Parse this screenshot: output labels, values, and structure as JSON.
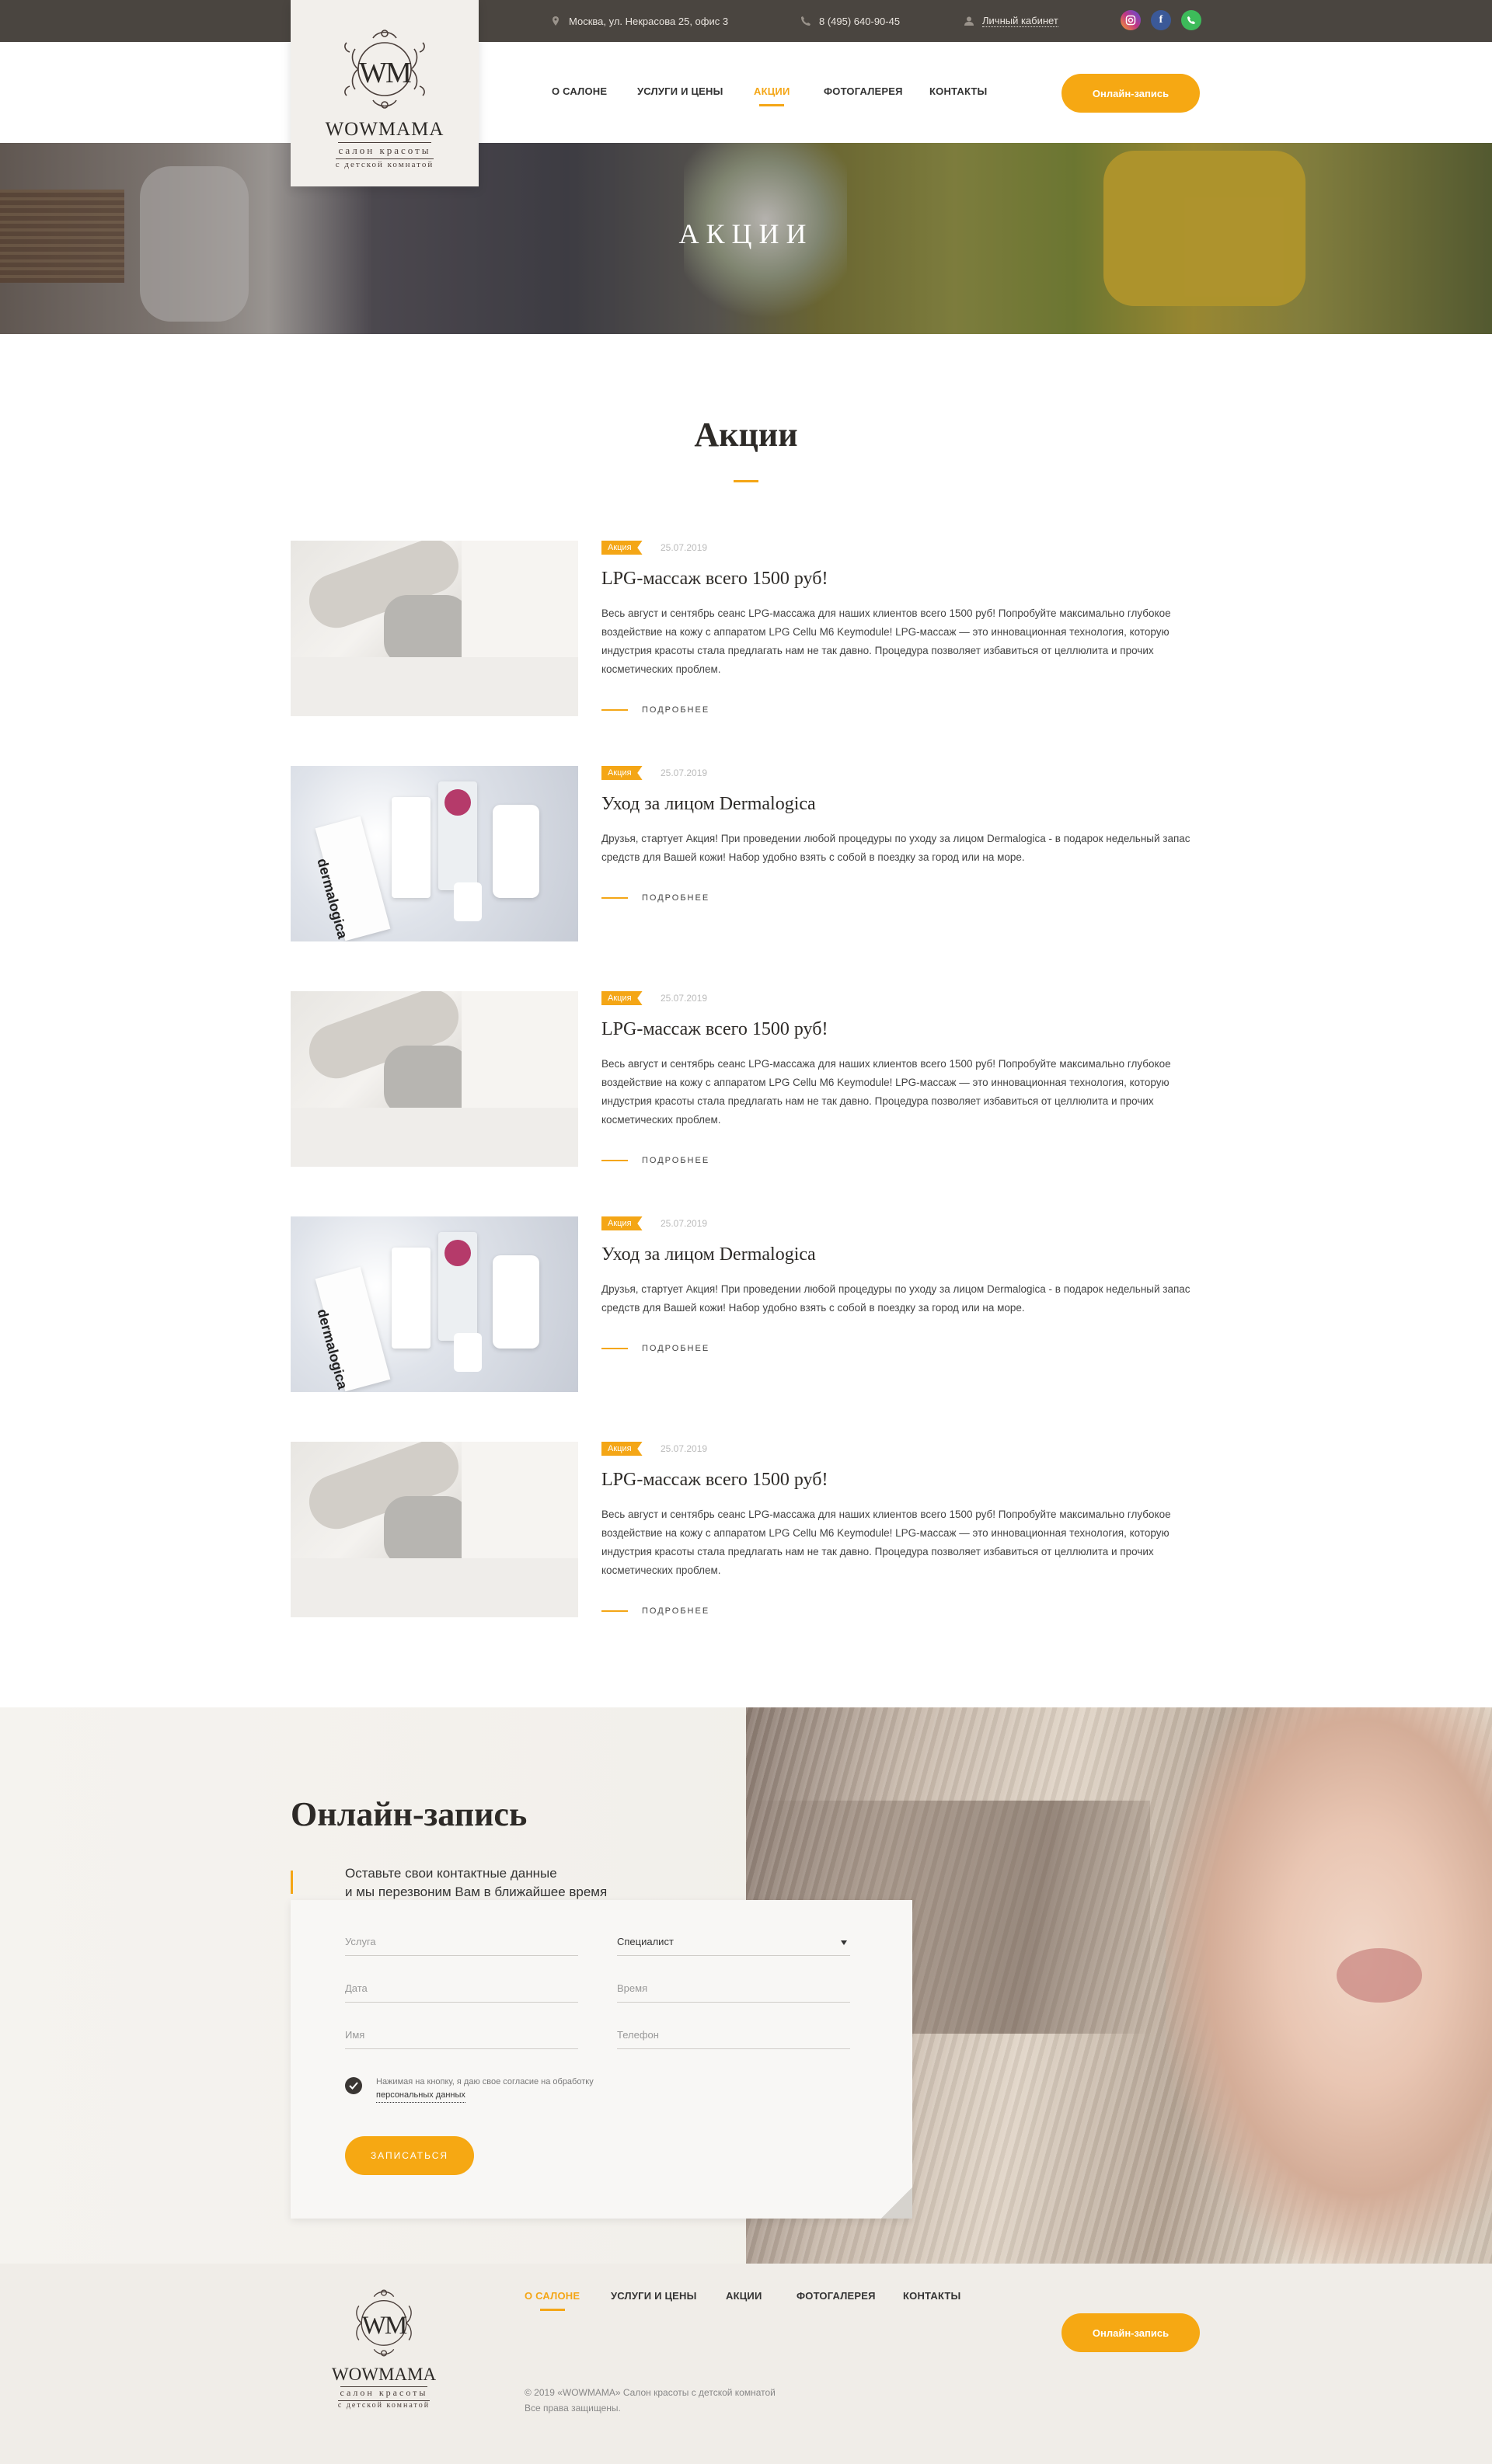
{
  "topbar": {
    "address": "Москва, ул. Некрасова 25, офис 3",
    "phone": "8 (495) 640-90-45",
    "account": "Личный кабинет",
    "social": [
      {
        "icon": "instagram-icon",
        "color": "#c13584"
      },
      {
        "icon": "facebook-icon",
        "color": "#3b5998",
        "glyph": "f"
      },
      {
        "icon": "whatsapp-icon",
        "color": "#3dbb5a"
      }
    ]
  },
  "logo": {
    "mono": "WM",
    "name": "WOWMAMA",
    "tag1": "салон красоты",
    "tag2": "с детской комнатой"
  },
  "nav": {
    "items": [
      "О салоне",
      "Услуги и цены",
      "Акции",
      "Фотогалерея",
      "Контакты"
    ],
    "active": 2,
    "cta": "Онлайн-запись"
  },
  "hero": {
    "title": "Акции"
  },
  "promos_section": {
    "title": "Акции"
  },
  "promos": [
    {
      "badge": "Акция",
      "date": "25.07.2019",
      "title": "LPG-массаж всего 1500 руб!",
      "text": "Весь август и сентябрь сеанс LPG-массажа для наших клиентов всего 1500 руб! Попробуйте максимально глубокое воздействие на кожу с аппаратом LPG Cellu M6 Keymodule!  LPG-массаж — это инновационная технология, которую индустрия красоты стала предлагать нам не так давно. Процедура позволяет избавиться от целлюлита и прочих косметических проблем.",
      "more": "Подробнее"
    },
    {
      "badge": "Акция",
      "date": "25.07.2019",
      "title": "Уход за лицом Dermalogica",
      "text": "Друзья, стартует Акция! При проведении любой процедуры по уходу за лицом Dermalogica - в подарок недельный запас средств для Вашей кожи! Набор удобно взять с собой в поездку за город или на море.",
      "more": "Подробнее"
    },
    {
      "badge": "Акция",
      "date": "25.07.2019",
      "title": "LPG-массаж всего 1500 руб!",
      "text": "Весь август и сентябрь сеанс LPG-массажа для наших клиентов всего 1500 руб! Попробуйте максимально глубокое воздействие на кожу с аппаратом LPG Cellu M6 Keymodule!  LPG-массаж — это инновационная технология, которую индустрия красоты стала предлагать нам не так давно. Процедура позволяет избавиться от целлюлита и прочих косметических проблем.",
      "more": "Подробнее"
    },
    {
      "badge": "Акция",
      "date": "25.07.2019",
      "title": "Уход за лицом Dermalogica",
      "text": "Друзья, стартует Акция! При проведении любой процедуры по уходу за лицом Dermalogica - в подарок недельный запас средств для Вашей кожи! Набор удобно взять с собой в поездку за город или на море.",
      "more": "Подробнее"
    },
    {
      "badge": "Акция",
      "date": "25.07.2019",
      "title": "LPG-массаж всего 1500 руб!",
      "text": "Весь август и сентябрь сеанс LPG-массажа для наших клиентов всего 1500 руб! Попробуйте максимально глубокое воздействие на кожу с аппаратом LPG Cellu M6 Keymodule!  LPG-массаж — это инновационная технология, которую индустрия красоты стала предлагать нам не так давно. Процедура позволяет избавиться от целлюлита и прочих косметических проблем.",
      "more": "Подробнее"
    }
  ],
  "product_label": "dermalogica",
  "booking": {
    "title": "Онлайн-запись",
    "subtitle1": "Оставьте свои контактные данные",
    "subtitle2": "и мы перезвоним Вам в ближайшее время",
    "fields": {
      "service": "Услуга",
      "specialist": "Специалист",
      "date": "Дата",
      "time": "Время",
      "name": "Имя",
      "phone": "Телефон"
    },
    "consent1": "Нажимая на кнопку, я даю свое согласие на обработку",
    "consent2": "персональных данных",
    "submit": "Записаться"
  },
  "footer": {
    "nav": [
      "О салоне",
      "Услуги и цены",
      "Акции",
      "Фотогалерея",
      "Контакты"
    ],
    "active": 0,
    "cta": "Онлайн-запись",
    "copyright": "© 2019 «WOWMAMA» Салон красоты с детской комнатой",
    "rights": "Все права защищены."
  },
  "colors": {
    "accent": "#f4a616",
    "topbar": "#4a4540",
    "text": "#2d2a27"
  }
}
